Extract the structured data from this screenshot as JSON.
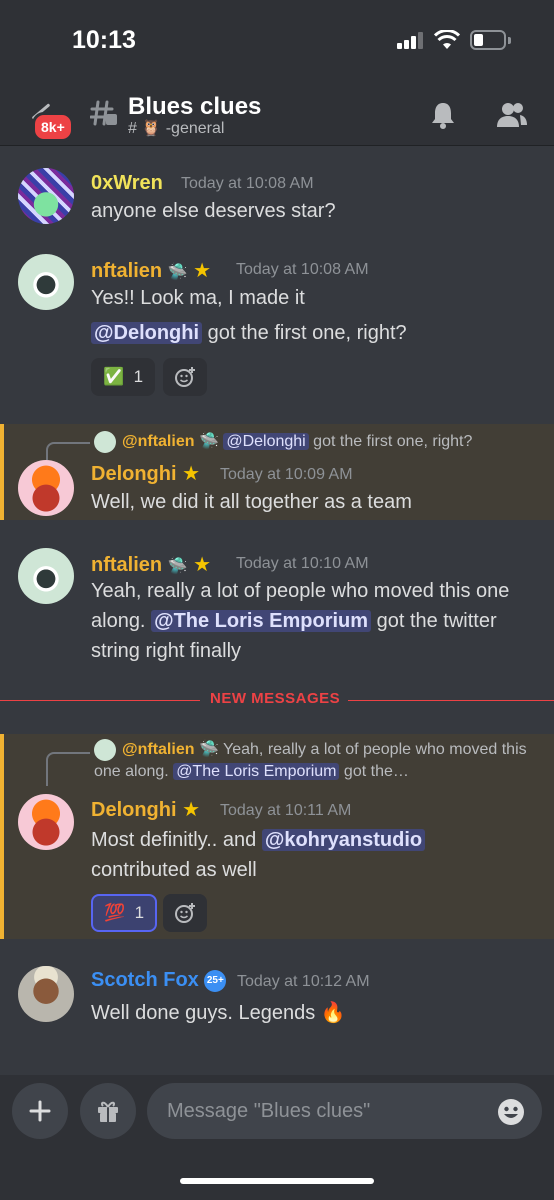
{
  "status_bar": {
    "time": "10:13"
  },
  "header": {
    "badge": "8k+",
    "channel_name": "Blues clues",
    "channel_sub": "# 🦉 -general"
  },
  "messages": [
    {
      "author": "0xWren",
      "author_color": "#f1e35a",
      "timestamp": "Today at 10:08 AM",
      "text": "anyone else deserves star?"
    },
    {
      "author": "nftalien",
      "author_color": "#f0b232",
      "timestamp": "Today at 10:08 AM",
      "text": "Yes!! Look ma, I made it",
      "mention": "@Delonghi",
      "text2": " got the first one, right?",
      "reaction": {
        "emoji": "✅",
        "count": "1"
      }
    },
    {
      "reply_author": "@nftalien",
      "reply_mention": "@Delonghi",
      "reply_text": " got the first one, right?",
      "author": "Delonghi",
      "author_color": "#f0b232",
      "timestamp": "Today at 10:09 AM",
      "text": "Well, we did it all together as a team"
    },
    {
      "author": "nftalien",
      "author_color": "#f0b232",
      "timestamp": "Today at 10:10 AM",
      "text": "Yeah, really a lot of people who moved this one along. ",
      "mention": "@The Loris Emporium",
      "text2": " got the twitter string right finally"
    },
    {
      "reply_author": "@nftalien",
      "reply_text": " Yeah, really a lot of people who moved this one along. ",
      "reply_mention": "@The Loris Emporium",
      "reply_text2": " got the…",
      "author": "Delonghi",
      "author_color": "#f0b232",
      "timestamp": "Today at 10:11 AM",
      "text": "Most definitly.. and ",
      "mention": "@kohryanstudio",
      "text2": " contributed as well",
      "reaction": {
        "emoji": "💯",
        "count": "1"
      }
    },
    {
      "author": "Scotch Fox",
      "author_color": "#3b8ff3",
      "boost_badge": "25+",
      "timestamp": "Today at 10:12 AM",
      "text": "Well done guys. Legends 🔥"
    }
  ],
  "divider_label": "NEW MESSAGES",
  "composer": {
    "placeholder": "Message \"Blues clues\""
  },
  "colors": {
    "background": "#36393f",
    "header": "#2f3136",
    "highlight": "#423e36",
    "accent_gold": "#f0b232",
    "mention_bg": "#414675",
    "new_messages": "#ed4245"
  }
}
